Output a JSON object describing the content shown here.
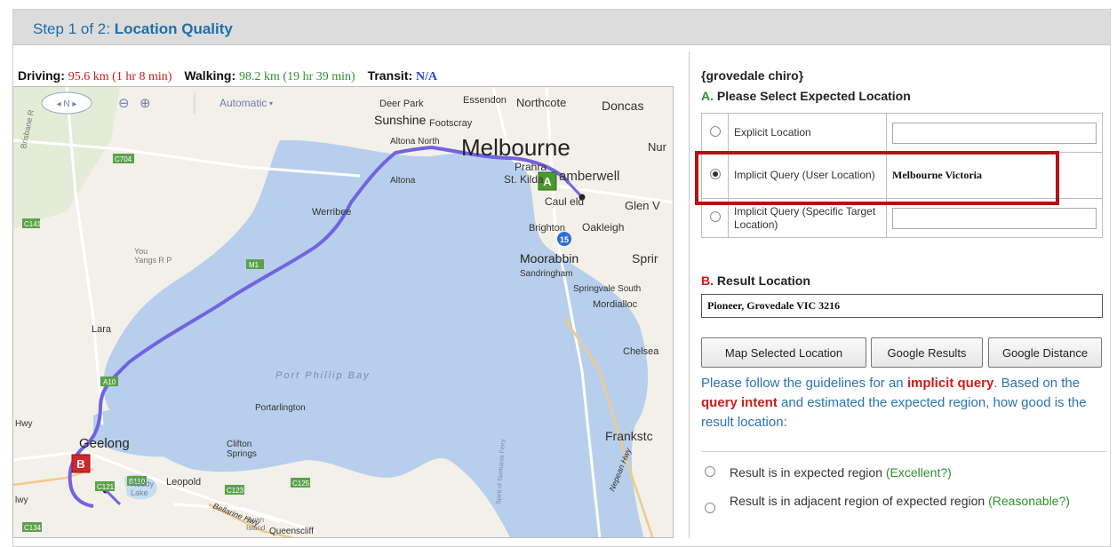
{
  "header": {
    "step_prefix": "Step 1 of 2: ",
    "step_title": "Location Quality"
  },
  "distances": {
    "driving_label": "Driving:",
    "driving_value": "95.6 km (1 hr 8 min)",
    "walking_label": "Walking:",
    "walking_value": "98.2 km (19 hr 39 min)",
    "transit_label": "Transit:",
    "transit_value": "N/A"
  },
  "map": {
    "style_selector": "Automatic",
    "pan_arrows": "◂ N ▸",
    "zoom_out": "⊖",
    "zoom_in": "⊕",
    "marker_a": "A",
    "marker_b": "B",
    "labels": {
      "melbourne": "Melbourne",
      "sunshine": "Sunshine",
      "footscray": "Footscray",
      "deer_park": "Deer Park",
      "essendon": "Essendon",
      "northcote": "Northcote",
      "doncaster": "Doncas",
      "nunawading": "Nur",
      "prahran": "Prahra",
      "st_kilda": "St. Kilda",
      "camberwell": "amberwell",
      "caulfield": "Caul eld",
      "glen_waverley": "Glen V",
      "altona_north": "Altona North",
      "altona": "Altona",
      "werribee": "Werribee",
      "brighton": "Brighton",
      "oakleigh": "Oakleigh",
      "moorabbin": "Moorabbin",
      "sandringham": "Sandringham",
      "springvale": "Sprir",
      "springvale_south": "Springvale South",
      "mordialloc": "Mordialloc",
      "you_yangs": "You\nYangs R P",
      "lara": "Lara",
      "port_phillip_bay": "Port Phillip Bay",
      "chelsea": "Chelsea",
      "portarlington": "Portarlington",
      "geelong": "Geelong",
      "frankston": "Frankstc",
      "clifton_springs": "Clifton\nSprings",
      "leopold": "Leopold",
      "reedy_lake": "Reedy\nLake",
      "swan_island": "Swan\nIsland",
      "queenscliff": "Queenscliff",
      "bellarine_hwy": "Bellarine Hwy",
      "hwy_left": "Hwy",
      "hwy_left2": "lwy",
      "nepean_hwy": "Nepean Hwy",
      "tasmania_ferry": "Spirit of Tasmania Ferry",
      "brisbane_ranges": "Brisbane R",
      "route_15": "15"
    },
    "road_badges": [
      "C704",
      "C141",
      "C134",
      "A10",
      "C121",
      "B110",
      "C123",
      "C125",
      "M1"
    ],
    "colors": {
      "water": "#b7cfec",
      "land": "#f3f0e9",
      "route": "#7263e2",
      "badge": "#5aa34a"
    }
  },
  "panel": {
    "query": "{grovedale chiro}",
    "section_a_letter": "A.",
    "section_a_title": " Please Select Expected Location",
    "options": [
      {
        "label": "Explicit Location",
        "value": "",
        "selected": false
      },
      {
        "label": "Implicit Query (User Location)",
        "value": "Melbourne Victoria",
        "selected": true
      },
      {
        "label": "Implicit Query (Specific Target Location)",
        "value": "",
        "selected": false
      }
    ],
    "section_b_letter": "B.",
    "section_b_title": " Result Location",
    "result_location": "Pioneer, Grovedale VIC 3216",
    "buttons": {
      "map_selected": "Map Selected Location",
      "google_results": "Google Results",
      "google_distance": "Google Distance"
    },
    "guide": {
      "p1": "Please follow the guidelines for an ",
      "em1": "implicit query",
      "p2": ". Based on the ",
      "em2": "query intent",
      "p3": " and estimated the expected region, how good is the result location:"
    },
    "ratings": [
      {
        "text": "Result is in expected region ",
        "hint": "(Excellent?)"
      },
      {
        "text": "Result is in adjacent region of expected region ",
        "hint": "(Reasonable?)"
      }
    ]
  }
}
